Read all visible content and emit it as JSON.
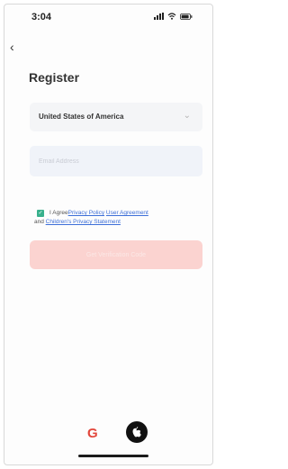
{
  "status_bar": {
    "time": "3:04"
  },
  "back_symbol": "‹",
  "page": {
    "title": "Register"
  },
  "country_select": {
    "value": "United States of America",
    "chevron": "⌄"
  },
  "email": {
    "placeholder": "Email Address",
    "value": ""
  },
  "agreement": {
    "checked": true,
    "prefix": "I Agree",
    "privacy_link": "Privacy Policy",
    "user_link": "User Agreement",
    "joiner": "and",
    "children_link": "Children's Privacy Statement"
  },
  "primary_button": {
    "label": "Get Verification Code"
  },
  "social": {
    "google_label": "G",
    "google_color": "#e2463b",
    "apple_color": "#111111"
  },
  "colors": {
    "accent": "#38b08c",
    "link": "#3d6fd8",
    "button_disabled": "#fbd3d0"
  },
  "icons": [
    "signal-icon",
    "wifi-icon",
    "battery-icon",
    "back-icon",
    "chevron-down-icon",
    "checkbox-icon",
    "google-icon",
    "apple-icon"
  ]
}
